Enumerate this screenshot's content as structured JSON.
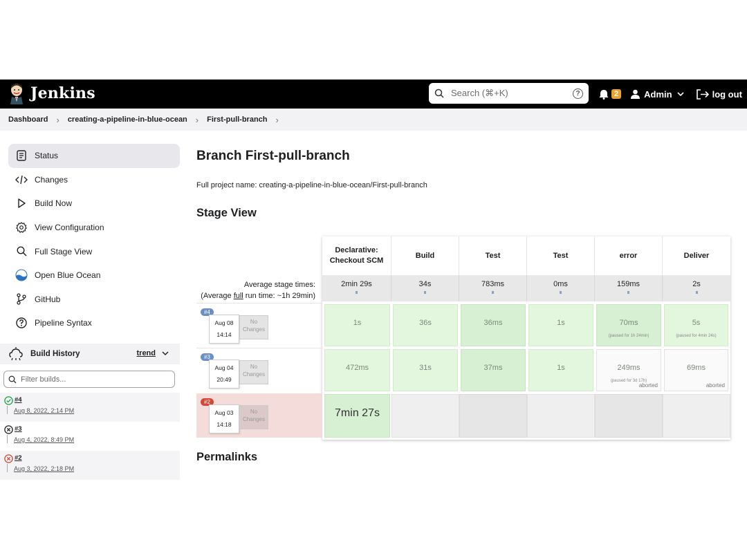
{
  "header": {
    "brand": "Jenkins",
    "search_placeholder": "Search (⌘+K)",
    "help_symbol": "?",
    "notifications_count": "2",
    "user": "Admin",
    "logout": "log out"
  },
  "breadcrumb": [
    "Dashboard",
    "creating-a-pipeline-in-blue-ocean",
    "First-pull-branch"
  ],
  "sidebar": {
    "items": [
      {
        "label": "Status",
        "icon": "document-icon"
      },
      {
        "label": "Changes",
        "icon": "code-icon"
      },
      {
        "label": "Build Now",
        "icon": "play-icon"
      },
      {
        "label": "View Configuration",
        "icon": "gear-icon"
      },
      {
        "label": "Full Stage View",
        "icon": "search-icon"
      },
      {
        "label": "Open Blue Ocean",
        "icon": "blue-ocean-icon"
      },
      {
        "label": "GitHub",
        "icon": "branch-icon"
      },
      {
        "label": "Pipeline Syntax",
        "icon": "help-icon"
      }
    ]
  },
  "build_history": {
    "title": "Build History",
    "trend": "trend",
    "filter_placeholder": "Filter builds...",
    "builds": [
      {
        "num": "#4",
        "date": "Aug 8, 2022, 2:14 PM",
        "status": "success"
      },
      {
        "num": "#3",
        "date": "Aug 4, 2022, 8:49 PM",
        "status": "aborted"
      },
      {
        "num": "#2",
        "date": "Aug 3, 2022, 2:18 PM",
        "status": "failed"
      }
    ]
  },
  "main": {
    "title": "Branch First-pull-branch",
    "full_name": "Full project name: creating-a-pipeline-in-blue-ocean/First-pull-branch",
    "stage_view_title": "Stage View",
    "permalinks_title": "Permalinks",
    "avg_label_1": "Average stage times:",
    "avg_label_2a": "(Average ",
    "avg_label_2b": "full",
    "avg_label_2c": " run time: ~1h 29min)"
  },
  "stages": [
    {
      "name": "Declarative: Checkout SCM",
      "avg": "2min 29s"
    },
    {
      "name": "Build",
      "avg": "34s"
    },
    {
      "name": "Test",
      "avg": "783ms"
    },
    {
      "name": "Test",
      "avg": "0ms"
    },
    {
      "name": "error",
      "avg": "159ms"
    },
    {
      "name": "Deliver",
      "avg": "2s"
    }
  ],
  "runs": [
    {
      "num": "#4",
      "date": "Aug 08",
      "time": "14:14",
      "changes": "No Changes",
      "status": "success",
      "cells": [
        {
          "v": "1s",
          "p": "",
          "ab": ""
        },
        {
          "v": "36s",
          "p": "",
          "ab": ""
        },
        {
          "v": "36ms",
          "p": "",
          "ab": ""
        },
        {
          "v": "1s",
          "p": "",
          "ab": ""
        },
        {
          "v": "70ms",
          "p": "(paused for 1h 24min)",
          "ab": ""
        },
        {
          "v": "5s",
          "p": "(paused for 4min 24s)",
          "ab": ""
        }
      ]
    },
    {
      "num": "#3",
      "date": "Aug 04",
      "time": "20:49",
      "changes": "No Changes",
      "status": "aborted",
      "cells": [
        {
          "v": "472ms",
          "p": "",
          "ab": ""
        },
        {
          "v": "31s",
          "p": "",
          "ab": ""
        },
        {
          "v": "37ms",
          "p": "",
          "ab": ""
        },
        {
          "v": "1s",
          "p": "",
          "ab": ""
        },
        {
          "v": "249ms",
          "p": "(paused for 3d 17h)",
          "ab": "aborted"
        },
        {
          "v": "69ms",
          "p": "",
          "ab": "aborted"
        }
      ]
    },
    {
      "num": "#2",
      "date": "Aug 03",
      "time": "14:18",
      "changes": "No Changes",
      "status": "failed",
      "cells": [
        {
          "v": "7min 27s",
          "p": "",
          "ab": ""
        },
        {
          "v": "",
          "p": "",
          "ab": ""
        },
        {
          "v": "",
          "p": "",
          "ab": ""
        },
        {
          "v": "",
          "p": "",
          "ab": ""
        },
        {
          "v": "",
          "p": "",
          "ab": ""
        },
        {
          "v": "",
          "p": "",
          "ab": ""
        }
      ]
    }
  ],
  "colors": {
    "header_bg": "#000000",
    "notification_badge": "#f0a32b",
    "success_cell": "#e3f7de",
    "failed_row": "#f3dcda",
    "build_badge_blue": "#6b8fc5",
    "build_badge_red": "#d24939"
  }
}
